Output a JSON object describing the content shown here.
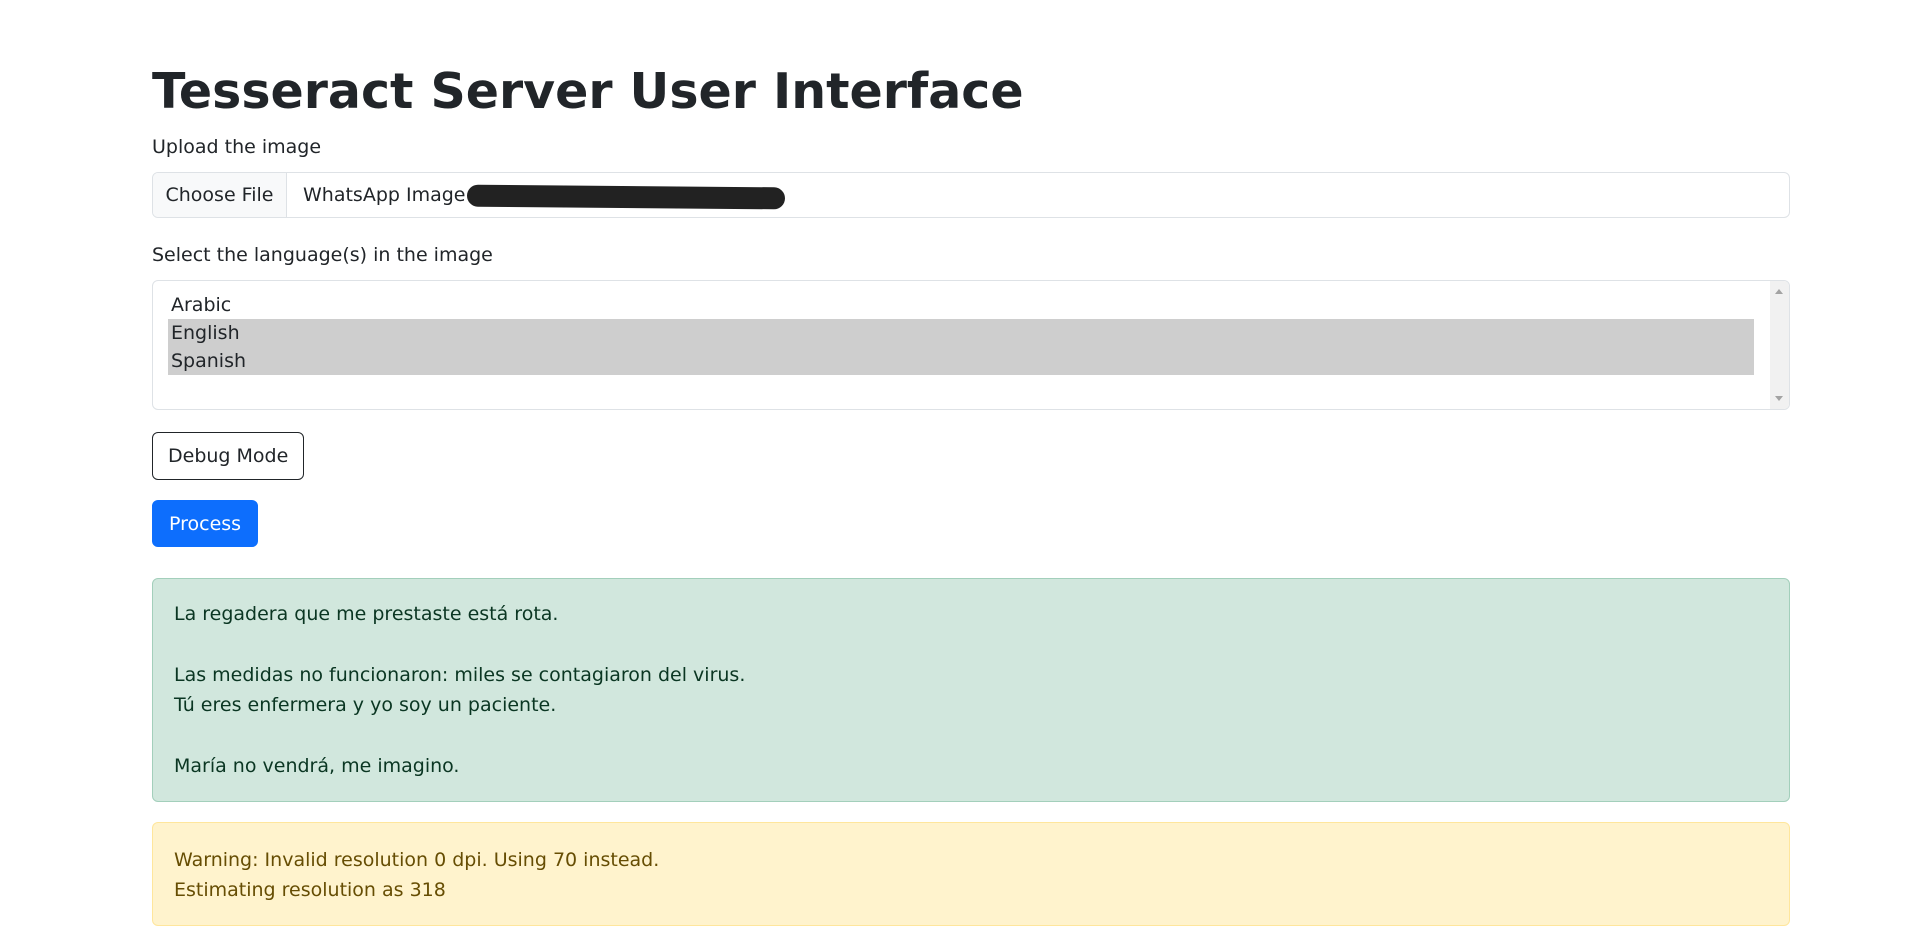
{
  "page": {
    "title": "Tesseract Server User Interface"
  },
  "upload": {
    "label": "Upload the image",
    "button_label": "Choose File",
    "file_name": "WhatsApp Image"
  },
  "languages": {
    "label": "Select the language(s) in the image",
    "options": [
      {
        "label": "Arabic",
        "selected": false
      },
      {
        "label": "English",
        "selected": true
      },
      {
        "label": "Spanish",
        "selected": true
      }
    ]
  },
  "buttons": {
    "debug_label": "Debug Mode",
    "process_label": "Process"
  },
  "result": {
    "lines": [
      "La regadera que me prestaste está rota.",
      "",
      "Las medidas no funcionaron: miles se contagiaron del virus.",
      "Tú eres enfermera y yo soy un paciente.",
      "",
      "María no vendrá, me imagino."
    ]
  },
  "warning": {
    "lines": [
      "Warning: Invalid resolution 0 dpi. Using 70 instead.",
      "Estimating resolution as 318"
    ]
  },
  "colors": {
    "primary": "#0d6efd",
    "success_bg": "#d1e7dd",
    "success_text": "#0a3622",
    "warning_bg": "#fff3cd",
    "warning_text": "#664d03",
    "selected_option_bg": "#cecece"
  }
}
